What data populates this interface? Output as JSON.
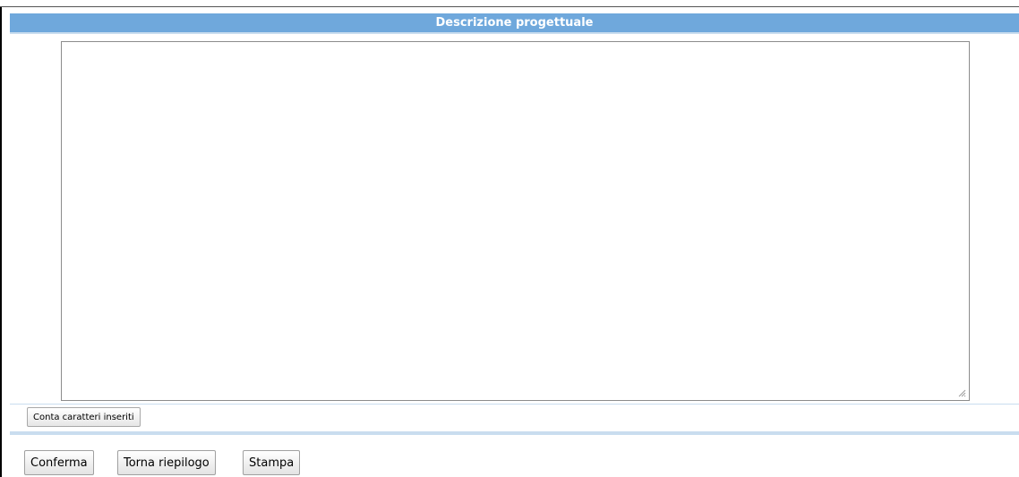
{
  "panel": {
    "title": "Descrizione progettuale"
  },
  "textarea": {
    "value": "",
    "placeholder": ""
  },
  "buttons": {
    "count_chars": "Conta caratteri inseriti",
    "confirm": "Conferma",
    "back_summary": "Torna riepilogo",
    "print": "Stampa"
  },
  "colors": {
    "header_bg": "#6fa8dc",
    "header_text": "#ffffff",
    "divider": "#c9ddef"
  }
}
